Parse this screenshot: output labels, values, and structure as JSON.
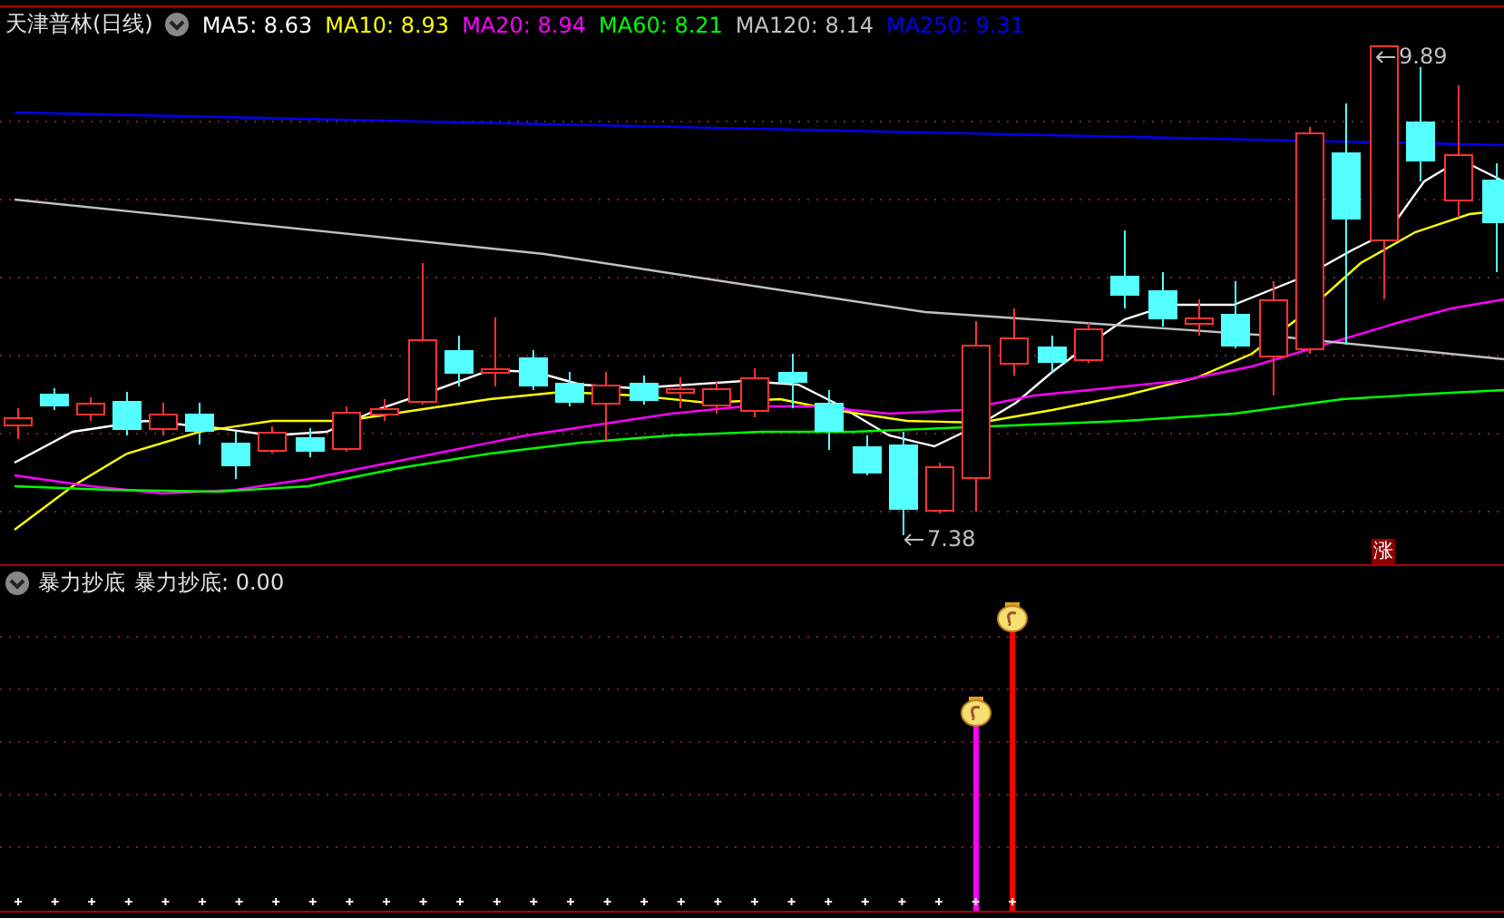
{
  "header": {
    "title": "天津普林(日线)",
    "averages": [
      {
        "text": "MA5: 8.63",
        "color": "#ffffff"
      },
      {
        "text": "MA10: 8.93",
        "color": "#ffff00"
      },
      {
        "text": "MA20: 8.94",
        "color": "#ff00ff"
      },
      {
        "text": "MA60: 8.21",
        "color": "#00ff00"
      },
      {
        "text": "MA120: 8.14",
        "color": "#c0c0c0"
      },
      {
        "text": "MA250: 9.31",
        "color": "#0000ff"
      }
    ]
  },
  "price_labels": {
    "high": "9.89",
    "low": "7.38"
  },
  "badge": "涨",
  "indicator": {
    "name": "暴力抄底",
    "reading": "暴力抄底: 0.00"
  }
}
